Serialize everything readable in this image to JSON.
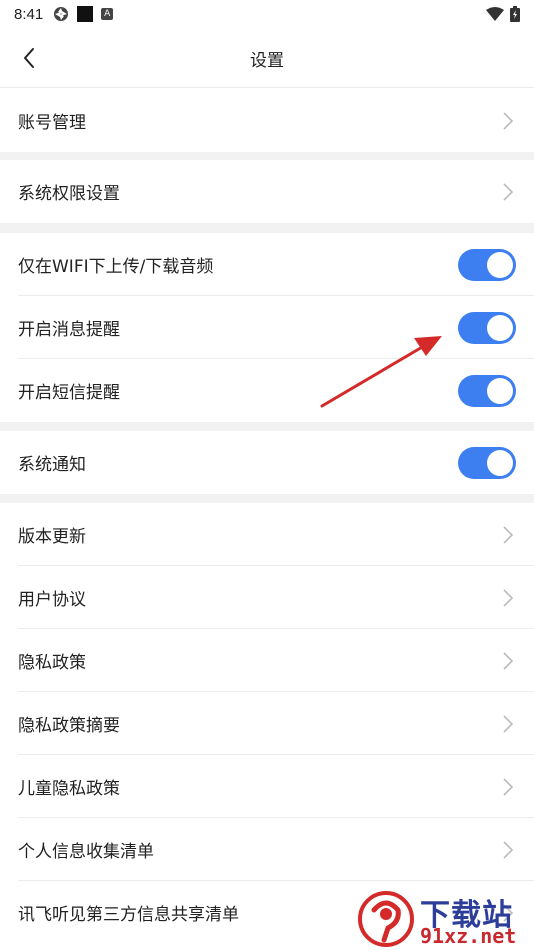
{
  "status_bar": {
    "time": "8:41",
    "badge_letter": "A"
  },
  "header": {
    "title": "设置"
  },
  "rows": {
    "account": "账号管理",
    "permissions": "系统权限设置",
    "wifi_only": "仅在WIFI下上传/下载音频",
    "msg_reminder": "开启消息提醒",
    "sms_reminder": "开启短信提醒",
    "system_notice": "系统通知",
    "version_update": "版本更新",
    "user_agreement": "用户协议",
    "privacy_policy": "隐私政策",
    "privacy_summary": "隐私政策摘要",
    "child_privacy": "儿童隐私政策",
    "personal_info": "个人信息收集清单",
    "third_party": "讯飞听见第三方信息共享清单"
  },
  "toggles": {
    "wifi_only": true,
    "msg_reminder": true,
    "sms_reminder": true,
    "system_notice": true
  },
  "colors": {
    "toggle_on": "#3d7ff0",
    "annotation_arrow": "#d42a2a",
    "section_gap": "#f2f2f2"
  },
  "watermark": {
    "line1": "下载站",
    "line2": "91xz.net"
  }
}
